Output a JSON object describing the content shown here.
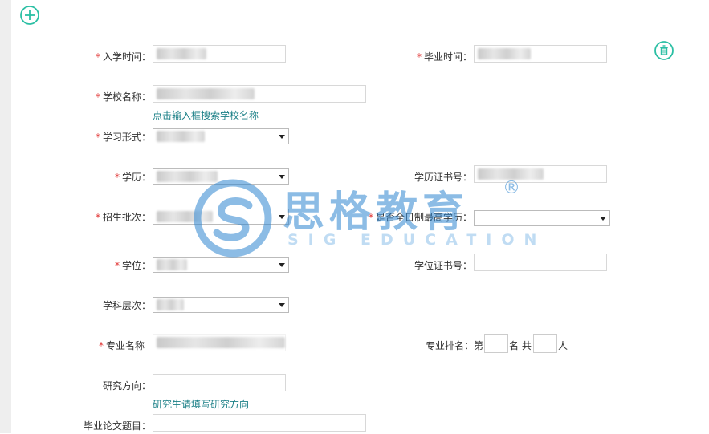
{
  "form": {
    "enroll_time_label": "入学时间：",
    "grad_time_label": "毕业时间：",
    "school_name_label": "学校名称：",
    "school_hint": "点击输入框搜索学校名称",
    "study_form_label": "学习形式：",
    "edu_label": "学历：",
    "edu_cert_label": "学历证书号：",
    "batch_label": "招生批次：",
    "fulltime_label": "是否全日制最高学历：",
    "degree_label": "学位：",
    "degree_cert_label": "学位证书号：",
    "discipline_label": "学科层次：",
    "major_label": "专业名称",
    "rank_label": "专业排名：",
    "rank_prefix": "第",
    "rank_middle": "名 共",
    "rank_suffix": "人",
    "research_label": "研究方向：",
    "research_hint": "研究生请填写研究方向",
    "thesis_label": "毕业论文题目："
  },
  "watermark": {
    "cn": "思格教育",
    "en": "SIG EDUCATION",
    "reg": "®"
  },
  "colors": {
    "accent": "#2bbfa4",
    "required": "#e0302f",
    "hint": "#1a7f86",
    "watermark": "#2f86d0"
  },
  "icons": {
    "add": "plus-circle-icon",
    "delete": "trash-icon"
  }
}
